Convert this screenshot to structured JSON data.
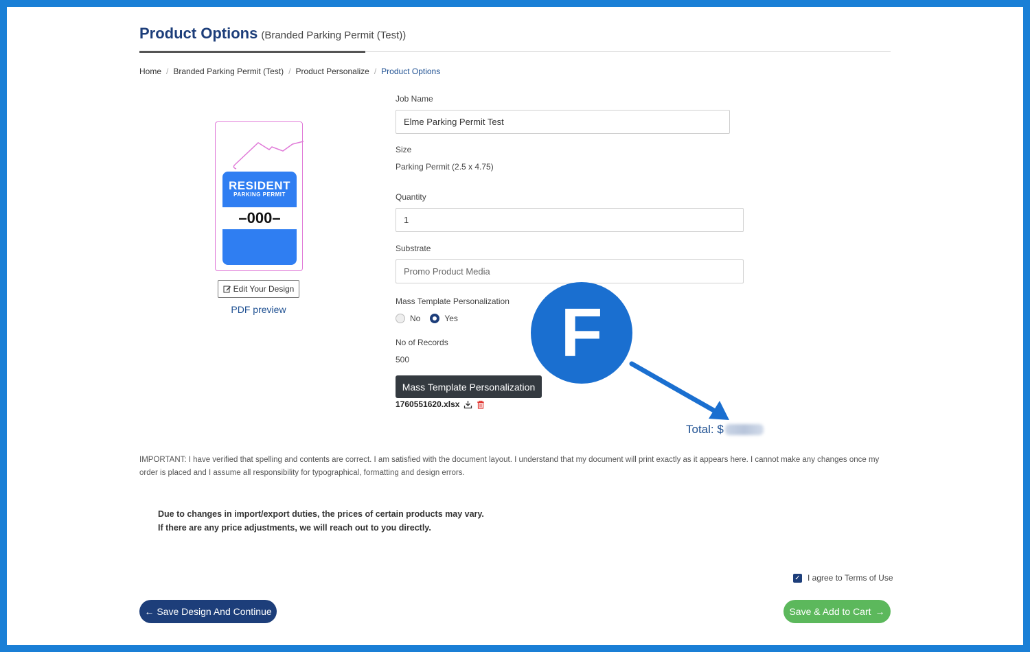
{
  "header": {
    "title": "Product Options",
    "subtitle": "(Branded Parking Permit (Test))"
  },
  "breadcrumb": [
    "Home",
    "Branded Parking Permit (Test)",
    "Product Personalize",
    "Product Options"
  ],
  "preview": {
    "line1": "RESIDENT",
    "line2": "PARKING PERMIT",
    "number": "–000–",
    "accent_color": "#2f7ef2",
    "border_color": "#e07ad8",
    "edit_button": "Edit Your Design",
    "pdf_link": "PDF preview"
  },
  "form": {
    "job_name_label": "Job Name",
    "job_name_value": "Elme Parking Permit Test",
    "size_label": "Size",
    "size_value": "Parking Permit (2.5 x 4.75)",
    "quantity_label": "Quantity",
    "quantity_value": "1",
    "substrate_label": "Substrate",
    "substrate_value": "Promo Product Media",
    "mtp_label": "Mass Template Personalization",
    "radio_no": "No",
    "radio_yes": "Yes",
    "radio_selected": "Yes",
    "records_label": "No of Records",
    "records_value": "500",
    "mtp_button": "Mass Template Personalization",
    "file_name": "1760551620.xlsx"
  },
  "total": {
    "label": "Total: $"
  },
  "callout": {
    "letter": "F",
    "color": "#1a6fd0"
  },
  "important_text": "IMPORTANT: I have verified that spelling and contents are correct. I am satisfied with the document layout. I understand that my document will print exactly as it appears here. I cannot make any changes once my order is placed and I assume all responsibility for typographical, formatting and design errors.",
  "notice": {
    "line1": "Due to changes in import/export duties, the prices of certain products may vary.",
    "line2": "If there are any price adjustments, we will reach out to you directly."
  },
  "terms_label": "I agree to Terms of Use",
  "buttons": {
    "save_continue": "Save Design And Continue",
    "add_to_cart": "Save & Add to Cart"
  },
  "colors": {
    "brand": "#1d3e7a",
    "link": "#1d4f91",
    "success": "#5cb85c",
    "frame": "#1a7fd6"
  }
}
